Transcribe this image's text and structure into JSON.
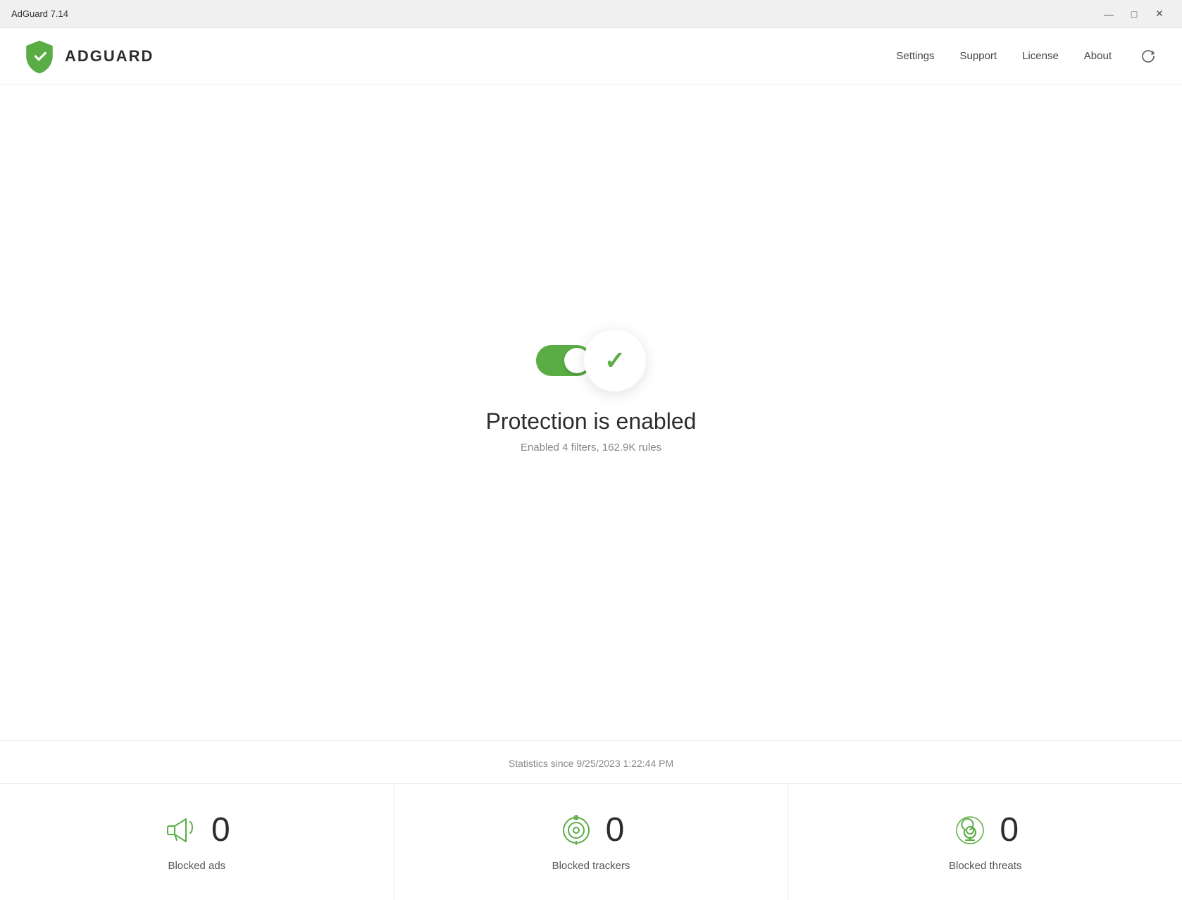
{
  "titlebar": {
    "title": "AdGuard 7.14",
    "minimize_label": "—",
    "maximize_label": "□",
    "close_label": "✕"
  },
  "header": {
    "logo_text": "ADGUARD",
    "nav": {
      "settings": "Settings",
      "support": "Support",
      "license": "License",
      "about": "About"
    }
  },
  "main": {
    "protection_title": "Protection is enabled",
    "protection_subtitle": "Enabled 4 filters, 162.9K rules"
  },
  "stats": {
    "date_label": "Statistics since 9/25/2023 1:22:44 PM",
    "items": [
      {
        "label": "Blocked ads",
        "value": "0",
        "icon": "megaphone-icon"
      },
      {
        "label": "Blocked trackers",
        "value": "0",
        "icon": "target-icon"
      },
      {
        "label": "Blocked threats",
        "value": "0",
        "icon": "biohazard-icon"
      }
    ]
  },
  "colors": {
    "green": "#5aac44",
    "text_dark": "#2d2d2d",
    "text_muted": "#888888"
  }
}
